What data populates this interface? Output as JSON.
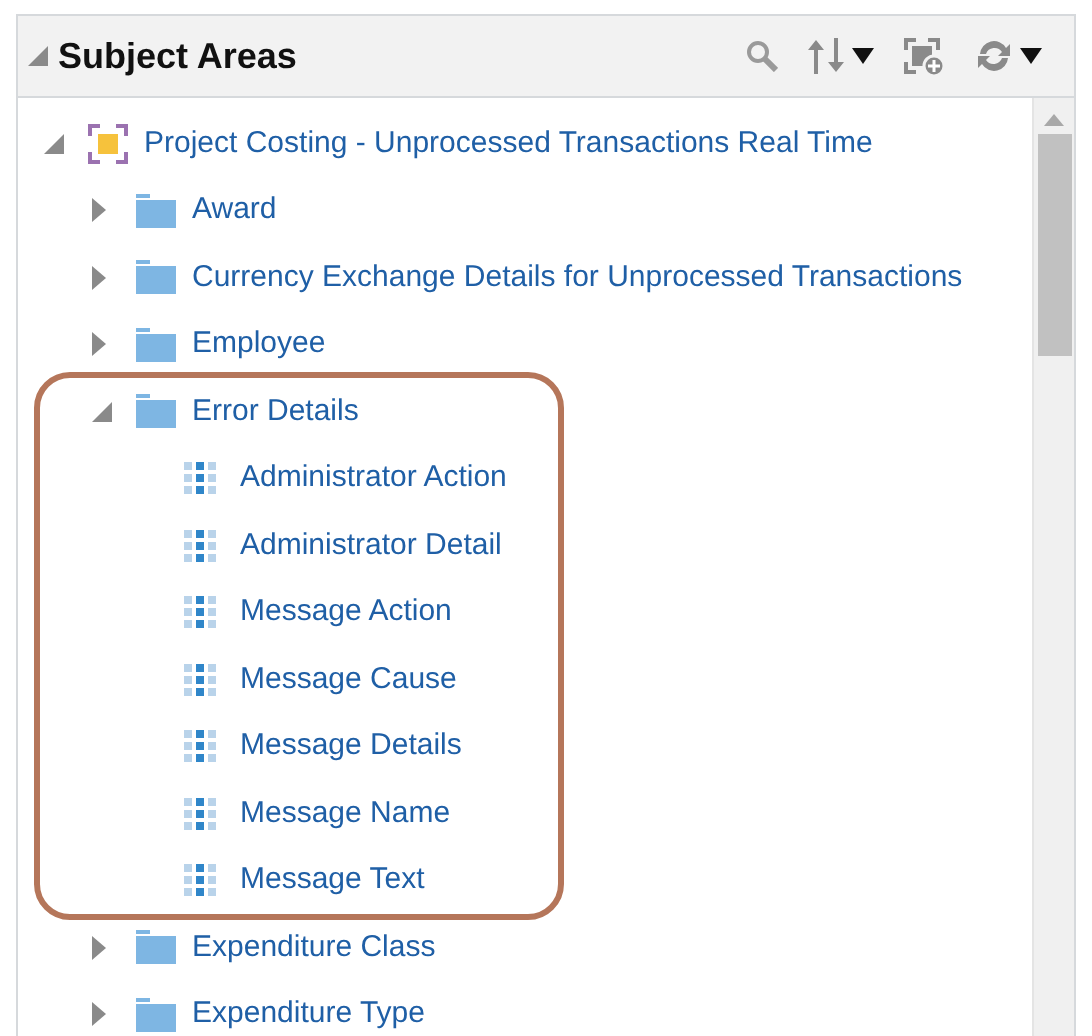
{
  "panel": {
    "title": "Subject Areas",
    "expanded": true
  },
  "toolbar": [
    {
      "kind": "search"
    },
    {
      "kind": "sort",
      "dropdown": true
    },
    {
      "kind": "add-view",
      "dropdown": false
    },
    {
      "kind": "refresh",
      "dropdown": true
    }
  ],
  "tree": [
    {
      "label": "Project Costing - Unprocessed Transactions Real Time",
      "kind": "subject-area",
      "expanded": true,
      "highlighted": false,
      "children": [
        {
          "label": "Award",
          "kind": "folder",
          "expanded": false,
          "highlighted": false
        },
        {
          "label": "Currency Exchange Details for Unprocessed Transactions",
          "kind": "folder",
          "expanded": false,
          "highlighted": false
        },
        {
          "label": "Employee",
          "kind": "folder",
          "expanded": false,
          "highlighted": false
        },
        {
          "label": "Error Details",
          "kind": "folder",
          "expanded": true,
          "highlighted": true,
          "children": [
            {
              "label": "Administrator Action",
              "kind": "column"
            },
            {
              "label": "Administrator Detail",
              "kind": "column"
            },
            {
              "label": "Message Action",
              "kind": "column"
            },
            {
              "label": "Message Cause",
              "kind": "column"
            },
            {
              "label": "Message Details",
              "kind": "column"
            },
            {
              "label": "Message Name",
              "kind": "column"
            },
            {
              "label": "Message Text",
              "kind": "column"
            }
          ]
        },
        {
          "label": "Expenditure Class",
          "kind": "folder",
          "expanded": false,
          "highlighted": false
        },
        {
          "label": "Expenditure Type",
          "kind": "folder",
          "expanded": false,
          "highlighted": false
        }
      ]
    }
  ]
}
